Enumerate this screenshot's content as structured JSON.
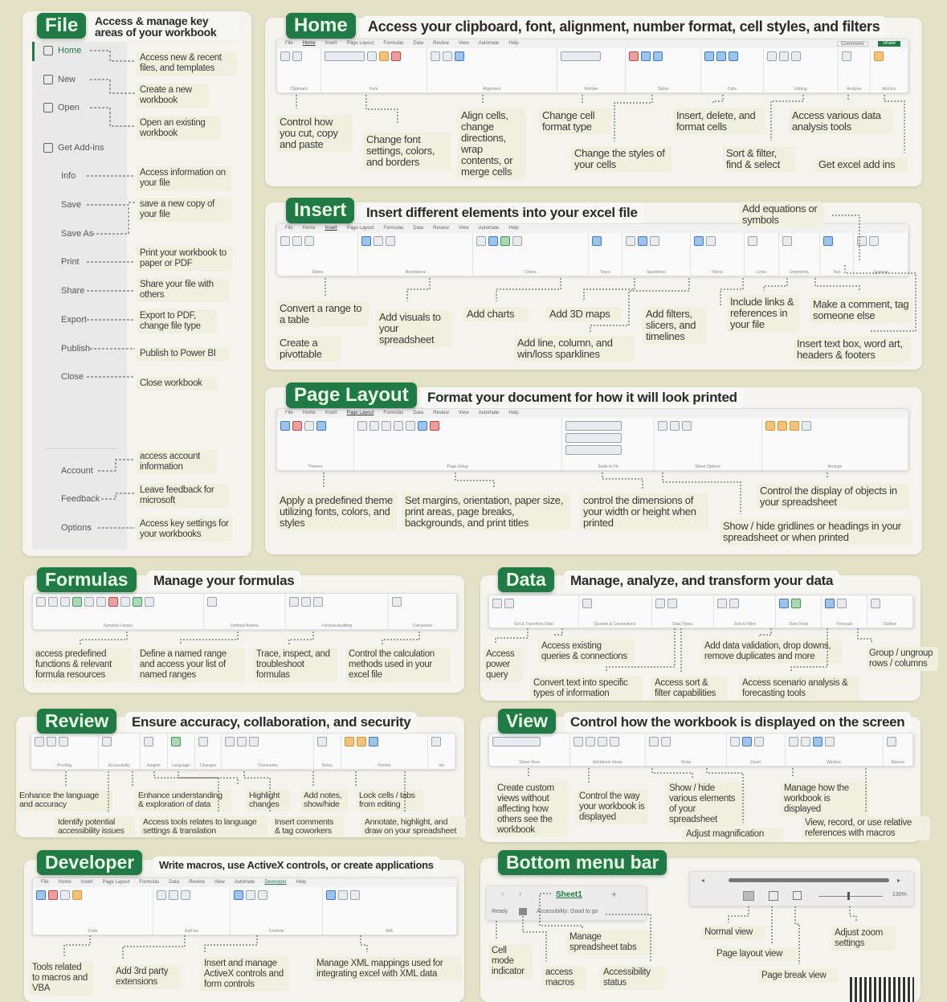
{
  "colors": {
    "background": "#e3e1c6",
    "tag_green": "#1f7a45",
    "note_bg": "#f1efdd"
  },
  "file": {
    "tag": "File",
    "subtitle": "Access & manage key areas of your workbook",
    "items": [
      {
        "label": "Home",
        "icon": "home-icon",
        "note": "Access new & recent files, and templates"
      },
      {
        "label": "New",
        "icon": "new-file-icon",
        "note": "Create a new workbook"
      },
      {
        "label": "Open",
        "icon": "open-folder-icon",
        "note": "Open an existing workbook"
      },
      {
        "label": "Get Add-ins",
        "icon": "add-ins-icon",
        "note": ""
      },
      {
        "label": "Info",
        "note": "Access information on your file"
      },
      {
        "label": "Save",
        "note": "save a new copy of your file"
      },
      {
        "label": "Save As",
        "note": ""
      },
      {
        "label": "Print",
        "note": "Print your workbook to paper or PDF"
      },
      {
        "label": "Share",
        "note": "Share your file with others"
      },
      {
        "label": "Export",
        "note": "Export to PDF, change file type"
      },
      {
        "label": "Publish",
        "note": "Publish to Power BI"
      },
      {
        "label": "Close",
        "note": "Close workbook"
      },
      {
        "label": "Account",
        "note": "access account information"
      },
      {
        "label": "Feedback",
        "note": "Leave feedback for microsoft"
      },
      {
        "label": "Options",
        "note": "Access key settings for your workbooks"
      }
    ]
  },
  "ribbon_tabs": [
    "File",
    "Home",
    "Insert",
    "Page Layout",
    "Formulas",
    "Data",
    "Review",
    "View",
    "Automate",
    "Help"
  ],
  "home": {
    "tag": "Home",
    "subtitle": "Access your clipboard, font, alignment, number format, cell styles, and filters",
    "groups": [
      "Clipboard",
      "Font",
      "Alignment",
      "Number",
      "Styles",
      "Cells",
      "Editing",
      "Analysis",
      "Add-ins"
    ],
    "share_label": "Share",
    "comments_label": "Comments",
    "notes": [
      "Control how you cut, copy and paste",
      "Change font settings, colors, and borders",
      "Align cells, change directions, wrap contents, or merge cells",
      "Change cell format type",
      "Change the styles of your cells",
      "Insert, delete, and format cells",
      "Sort & filter, find & select",
      "Access various data analysis tools",
      "Get excel add ins"
    ]
  },
  "insert": {
    "tag": "Insert",
    "subtitle": "Insert different elements into your excel file",
    "groups": [
      "Tables",
      "Illustrations",
      "Charts",
      "Tours",
      "Sparklines",
      "Filters",
      "Links",
      "Comments",
      "Text",
      "Symbols"
    ],
    "notes": [
      "Convert a range to a table",
      "Create a pivottable",
      "Add visuals to your spreadsheet",
      "Add charts",
      "Add 3D maps",
      "Add line, column, and win/loss sparklines",
      "Add filters, slicers, and timelines",
      "Include links & references in your file",
      "Make a comment, tag someone else",
      "Insert text box, word art, headers & footers",
      "Add equations or symbols"
    ]
  },
  "page_layout": {
    "tag": "Page Layout",
    "subtitle": "Format your document for how it will look printed",
    "groups": [
      "Themes",
      "Page Setup",
      "Scale to Fit",
      "Sheet Options",
      "Arrange"
    ],
    "notes": [
      "Apply a predefined theme utilizing fonts, colors, and styles",
      "Set margins, orientation, paper size, print areas, page breaks, backgrounds, and print titles",
      "control the dimensions of your width or height when printed",
      "Show / hide gridlines or headings in your spreadsheet or when printed",
      "Control the display of objects in your spreadsheet"
    ]
  },
  "formulas": {
    "tag": "Formulas",
    "subtitle": "Manage your formulas",
    "groups": [
      "Function Library",
      "Defined Names",
      "Formula Auditing",
      "Calculation"
    ],
    "notes": [
      "access predefined functions & relevant formula resources",
      "Define a named range and access your list of named ranges",
      "Trace, inspect, and troubleshoot formulas",
      "Control the calculation methods used in your excel file"
    ]
  },
  "data": {
    "tag": "Data",
    "subtitle": "Manage, analyze, and transform your data",
    "groups": [
      "Get & Transform Data",
      "Queries & Connections",
      "Data Types",
      "Sort & Filter",
      "Data Tools",
      "Forecast",
      "Outline"
    ],
    "notes": [
      "Access power query",
      "Access existing queries & connections",
      "Convert text into specific types of information",
      "Access sort & filter capabilities",
      "Add data validation, drop downs, remove duplicates and more",
      "Access scenario analysis & forecasting tools",
      "Group / ungroup rows / columns"
    ]
  },
  "review": {
    "tag": "Review",
    "subtitle": "Ensure accuracy, collaboration, and security",
    "groups": [
      "Proofing",
      "Accessibility",
      "Insights",
      "Language",
      "Changes",
      "Comments",
      "Notes",
      "Protect",
      "Ink"
    ],
    "notes": [
      "Enhance the language and accuracy",
      "Identify potential accessibility issues",
      "Enhance understanding & exploration of data",
      "Access tools relates to language settings & translation",
      "Highlight changes",
      "Insert comments & tag coworkers",
      "Add notes, show/hide",
      "Lock cells / tabs from editing",
      "Annotate, highlight, and draw on your spreadsheet"
    ]
  },
  "view": {
    "tag": "View",
    "subtitle": "Control how the workbook is displayed on the screen",
    "groups": [
      "Sheet View",
      "Workbook Views",
      "Show",
      "Zoom",
      "Window",
      "Macros"
    ],
    "notes": [
      "Create custom views without affecting how others see the workbook",
      "Control the way your workbook is displayed",
      "Show / hide various elements of your spreadsheet",
      "Adjust magnification",
      "Manage how the workbook is displayed",
      "View, record, or use relative references with macros"
    ]
  },
  "developer": {
    "tag": "Developer",
    "subtitle": "Write macros, use ActiveX controls, or create applications",
    "active_tab": "Developer",
    "groups": [
      "Code",
      "Add-ins",
      "Controls",
      "XML"
    ],
    "notes": [
      "Tools related to macros and VBA",
      "Add 3rd party extensions",
      "Insert and manage ActiveX controls and form controls",
      "Manage XML mappings used for integrating excel with XML data"
    ]
  },
  "bottom_bar": {
    "tag": "Bottom menu bar",
    "sheet_tab": "Sheet1",
    "status": "Ready",
    "accessibility": "Accessibility: Good to go",
    "zoom": "130%",
    "notes": [
      "Cell mode indicator",
      "access macros",
      "Manage spreadsheet tabs",
      "Accessibility status",
      "Normal view",
      "Page layout view",
      "Page break view",
      "Adjust zoom settings"
    ]
  }
}
